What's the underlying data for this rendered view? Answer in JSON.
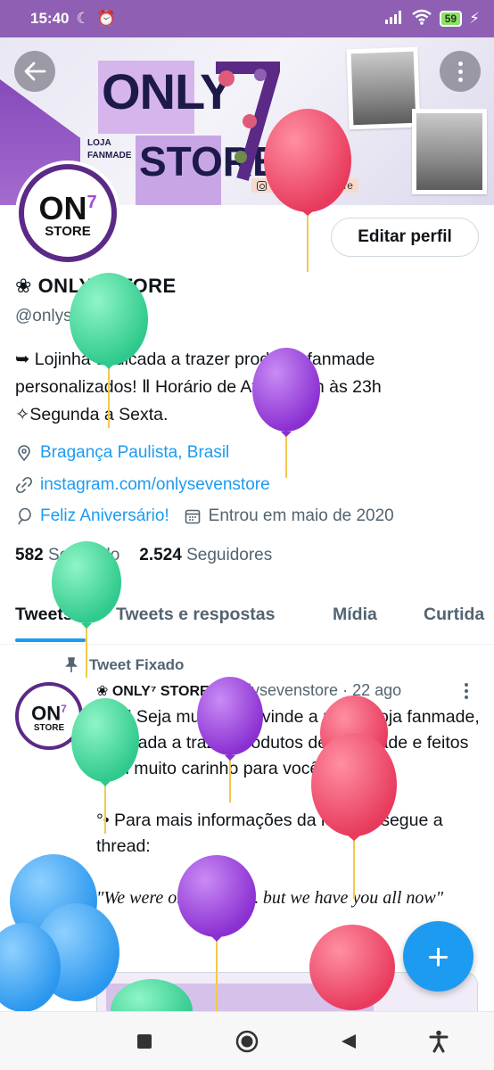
{
  "status_bar": {
    "time": "15:40",
    "battery": "59"
  },
  "banner": {
    "title_line1": "ONLY",
    "title_line2": "STORE",
    "tag_line1": "LOJA",
    "tag_line2": "FANMADE",
    "instagram": "@onlysevenstore",
    "brand_color": "#8e5fb3"
  },
  "avatar": {
    "text": "ON",
    "sup": "7",
    "store": "STORE"
  },
  "actions": {
    "edit_profile": "Editar perfil"
  },
  "profile": {
    "name": "ONLY⁷ STORE",
    "name_icon": "❀",
    "handle": "@onlysevenstore",
    "bio_line1": "➥ Lojinha dedicada a trazer produtos fanmade",
    "bio_line2": "personalizados!  Ⅱ Horário de Atend: 08h às 23h",
    "bio_line3": "✧Segunda a Sexta.",
    "location": "Bragança Paulista, Brasil",
    "website": "instagram.com/onlysevenstore",
    "birthday": "Feliz Aniversário!",
    "joined": "Entrou em maio de 2020",
    "following_count": "582",
    "following_label": "Seguindo",
    "followers_count": "2.524",
    "followers_label": "Seguidores"
  },
  "tabs": [
    {
      "label": "Tweets"
    },
    {
      "label": "Tweets e respostas"
    },
    {
      "label": "Mídia"
    },
    {
      "label": "Curtida"
    }
  ],
  "tweet": {
    "pinned_label": "Tweet Fixado",
    "author_name": "❀ ONLY⁷ STORE",
    "author_handle": "@onlysevenstore",
    "time": "· 22 ago",
    "avatar_text": "ON",
    "avatar_sup": "7",
    "avatar_store": "STORE",
    "para1": "[ᴏɴ⁷] Seja muito bem vinde a minha loja fanmade, dedicada a trazer produtos de qualidade e feitos com muito carinho para você!",
    "para2": "°• Para mais informações da lojinha, segue a thread:",
    "quote": "\"We were only seven… but we have you all now\""
  },
  "fab": {
    "icon": "plus-icon",
    "label": "+"
  },
  "accent_color": "#1d9bf0"
}
